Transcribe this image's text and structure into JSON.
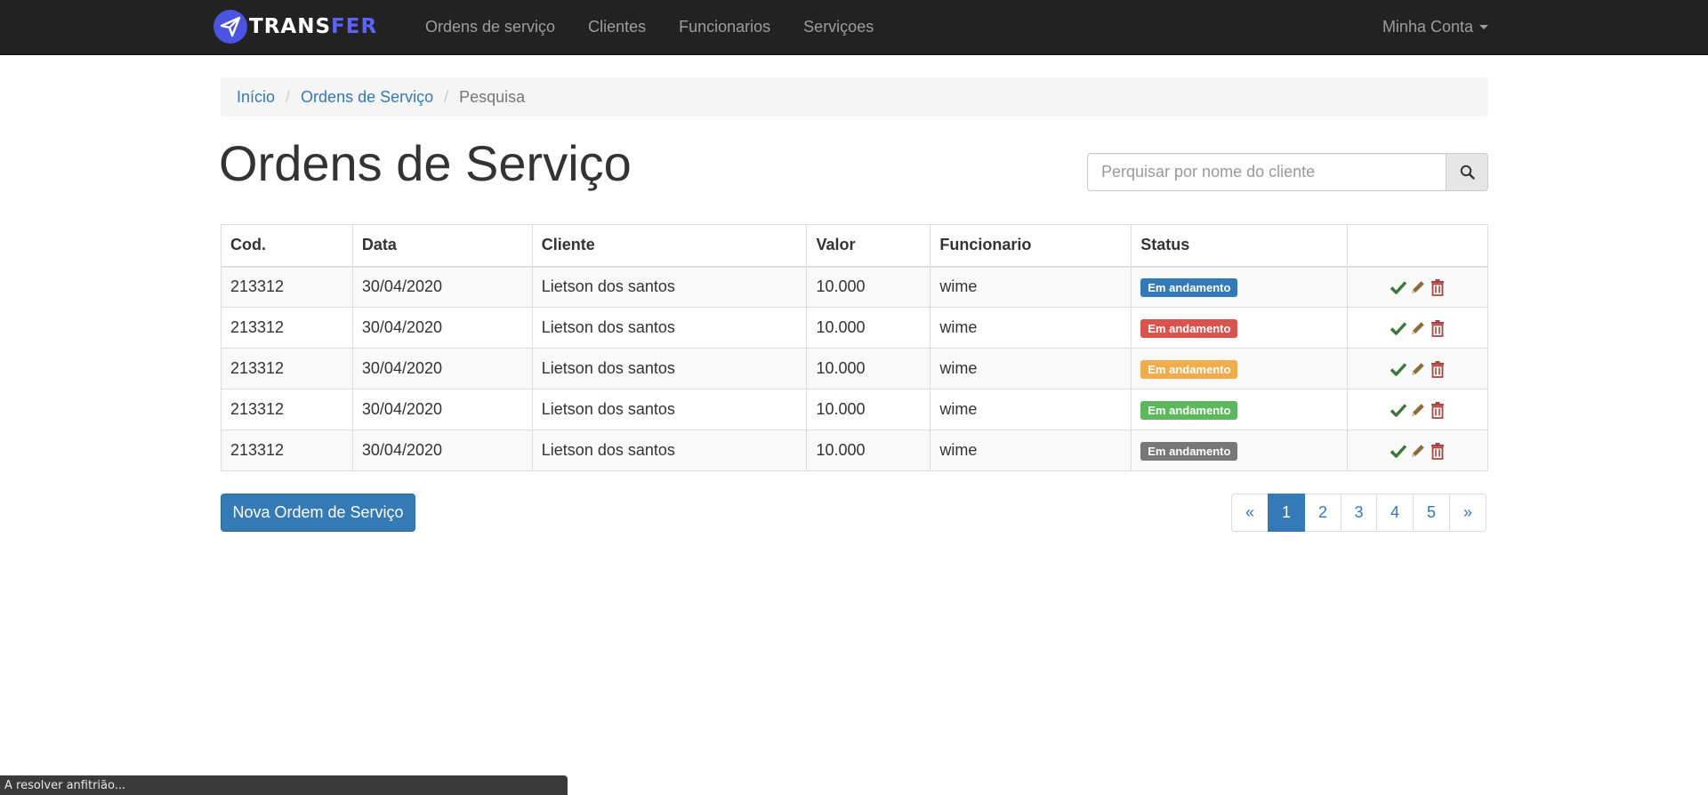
{
  "navbar": {
    "brand_part1": "TRANS",
    "brand_part2": "FER",
    "brand_icon": "paper-plane-logo-icon",
    "links": [
      "Ordens de serviço",
      "Clientes",
      "Funcionarios",
      "Serviçoes"
    ],
    "account_label": "Minha Conta"
  },
  "breadcrumb": {
    "items": [
      "Início",
      "Ordens de Serviço"
    ],
    "active": "Pesquisa"
  },
  "page_title": "Ordens de Serviço",
  "search": {
    "placeholder": "Perquisar por nome do cliente",
    "icon": "search-icon"
  },
  "table": {
    "headers": [
      "Cod.",
      "Data",
      "Cliente",
      "Valor",
      "Funcionario",
      "Status",
      ""
    ],
    "rows": [
      {
        "cod": "213312",
        "data": "30/04/2020",
        "cliente": "Lietson dos santos",
        "valor": "10.000",
        "funcionario": "wime",
        "status": "Em andamento",
        "status_color": "#337ab7"
      },
      {
        "cod": "213312",
        "data": "30/04/2020",
        "cliente": "Lietson dos santos",
        "valor": "10.000",
        "funcionario": "wime",
        "status": "Em andamento",
        "status_color": "#d9534f"
      },
      {
        "cod": "213312",
        "data": "30/04/2020",
        "cliente": "Lietson dos santos",
        "valor": "10.000",
        "funcionario": "wime",
        "status": "Em andamento",
        "status_color": "#f0ad4e"
      },
      {
        "cod": "213312",
        "data": "30/04/2020",
        "cliente": "Lietson dos santos",
        "valor": "10.000",
        "funcionario": "wime",
        "status": "Em andamento",
        "status_color": "#5cb85c"
      },
      {
        "cod": "213312",
        "data": "30/04/2020",
        "cliente": "Lietson dos santos",
        "valor": "10.000",
        "funcionario": "wime",
        "status": "Em andamento",
        "status_color": "#777777"
      }
    ],
    "action_icons": [
      "check-icon",
      "pencil-icon",
      "trash-icon"
    ],
    "action_colors": {
      "check": "#3c763d",
      "pencil": "#8a6d3b",
      "trash": "#a94442"
    }
  },
  "new_button_label": "Nova Ordem de Serviço",
  "pagination": {
    "prev": "«",
    "pages": [
      "1",
      "2",
      "3",
      "4",
      "5"
    ],
    "next": "»",
    "active_page": "1"
  },
  "status_bar": "A resolver anfitrião...",
  "colors": {
    "navbar_bg": "#222222",
    "primary": "#337ab7",
    "brand_accent": "#5c63ff"
  }
}
